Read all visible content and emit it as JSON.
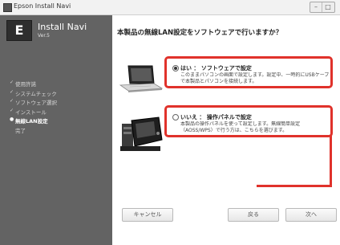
{
  "window": {
    "title": "Epson Install Navi"
  },
  "sidebar": {
    "logo_letter": "E",
    "app_name": "Install Navi",
    "version": "Ver.5",
    "steps": [
      {
        "label": "使用許諾",
        "mark": "✓",
        "state": "done"
      },
      {
        "label": "システムチェック",
        "mark": "✓",
        "state": "done"
      },
      {
        "label": "ソフトウェア選択",
        "mark": "✓",
        "state": "done"
      },
      {
        "label": "インストール",
        "mark": "✓",
        "state": "done"
      },
      {
        "label": "無線LAN設定",
        "mark": "●",
        "state": "current"
      },
      {
        "label": "完了",
        "mark": "",
        "state": "pending"
      }
    ]
  },
  "main": {
    "question": "本製品の無線LAN設定をソフトウェアで行いますか？",
    "options": [
      {
        "title": "はい ： ソフトウェアで設定",
        "description_line1": "このままパソコンの画面で設定します。設定中、一時的にUSBケーブル",
        "description_line2": "で本製品とパソコンを接続します。",
        "selected": true,
        "icon": "laptop-icon"
      },
      {
        "title": "いいえ ： 操作パネルで設定",
        "description_line1": "本製品の操作パネルを使って設定します。無線簡単設定",
        "description_line2": "（AOSS/WPS）で行う方は、こちらを選びます。",
        "selected": false,
        "icon": "control-panel-icon"
      }
    ]
  },
  "footer": {
    "cancel_label": "キャンセル",
    "back_label": "戻る",
    "next_label": "次へ"
  },
  "colors": {
    "highlight": "#e0322b",
    "sidebar_bg": "#636363"
  }
}
